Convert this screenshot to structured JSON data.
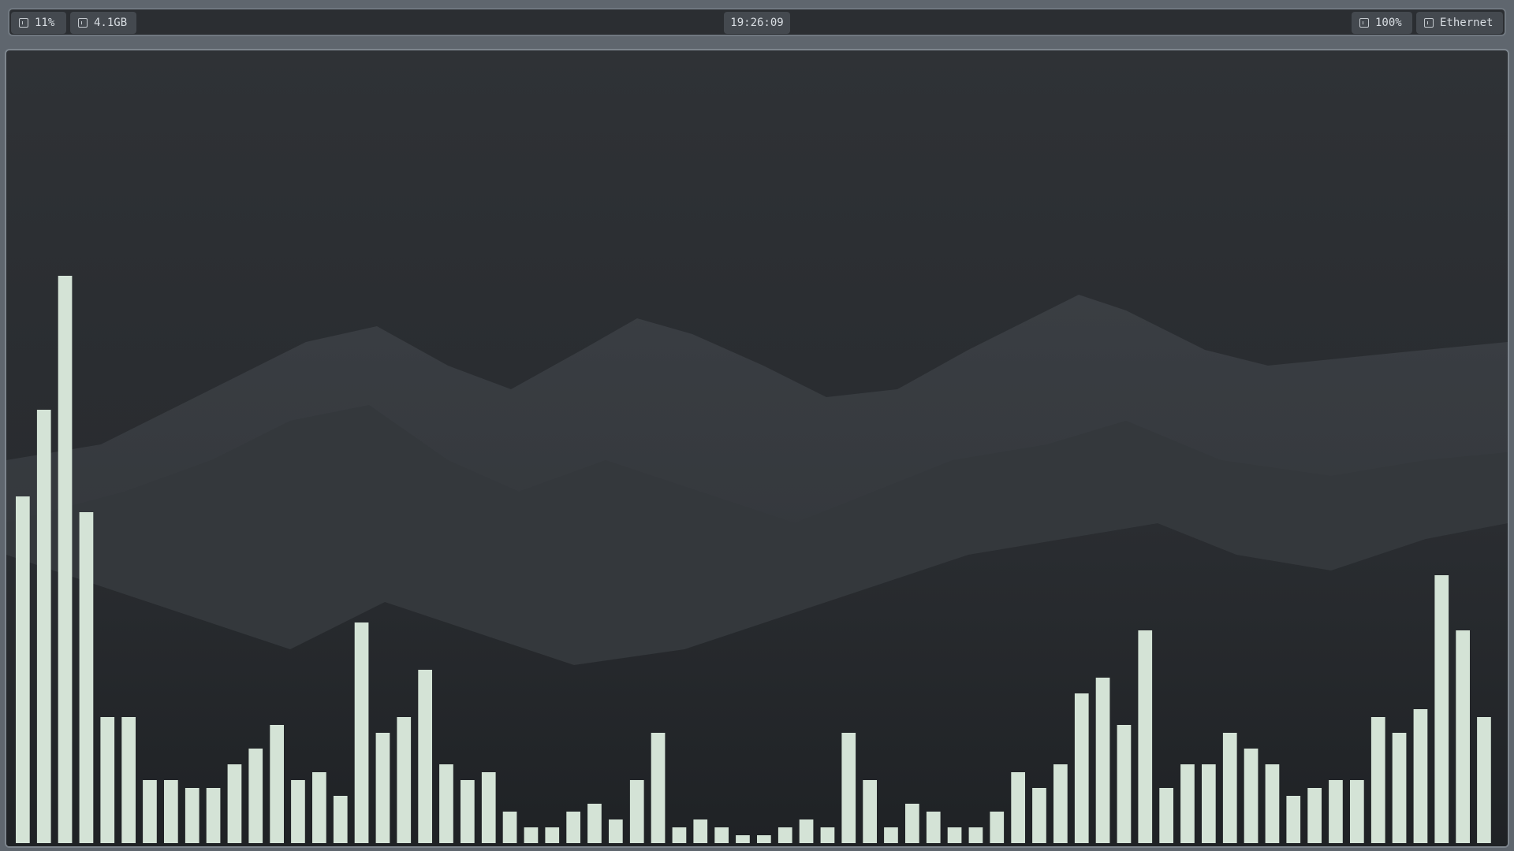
{
  "topbar": {
    "cpu": {
      "icon": "cpu-icon",
      "value": "11%"
    },
    "memory": {
      "icon": "memory-icon",
      "value": "4.1GB"
    },
    "clock": {
      "value": "19:26:09"
    },
    "volume": {
      "icon": "volume-icon",
      "value": "100%"
    },
    "network": {
      "icon": "network-icon",
      "value": "Ethernet"
    }
  },
  "visualizer": {
    "bar_color": "#d4e3d6",
    "levels": [
      0.44,
      0.55,
      0.72,
      0.42,
      0.16,
      0.16,
      0.08,
      0.08,
      0.07,
      0.07,
      0.1,
      0.12,
      0.15,
      0.08,
      0.09,
      0.06,
      0.28,
      0.14,
      0.16,
      0.22,
      0.1,
      0.08,
      0.09,
      0.04,
      0.02,
      0.02,
      0.04,
      0.05,
      0.03,
      0.08,
      0.14,
      0.02,
      0.03,
      0.02,
      0.01,
      0.01,
      0.02,
      0.03,
      0.02,
      0.14,
      0.08,
      0.02,
      0.05,
      0.04,
      0.02,
      0.02,
      0.04,
      0.09,
      0.07,
      0.1,
      0.19,
      0.21,
      0.15,
      0.27,
      0.07,
      0.1,
      0.1,
      0.14,
      0.12,
      0.1,
      0.06,
      0.07,
      0.08,
      0.08,
      0.16,
      0.14,
      0.17,
      0.34,
      0.27,
      0.16
    ]
  }
}
